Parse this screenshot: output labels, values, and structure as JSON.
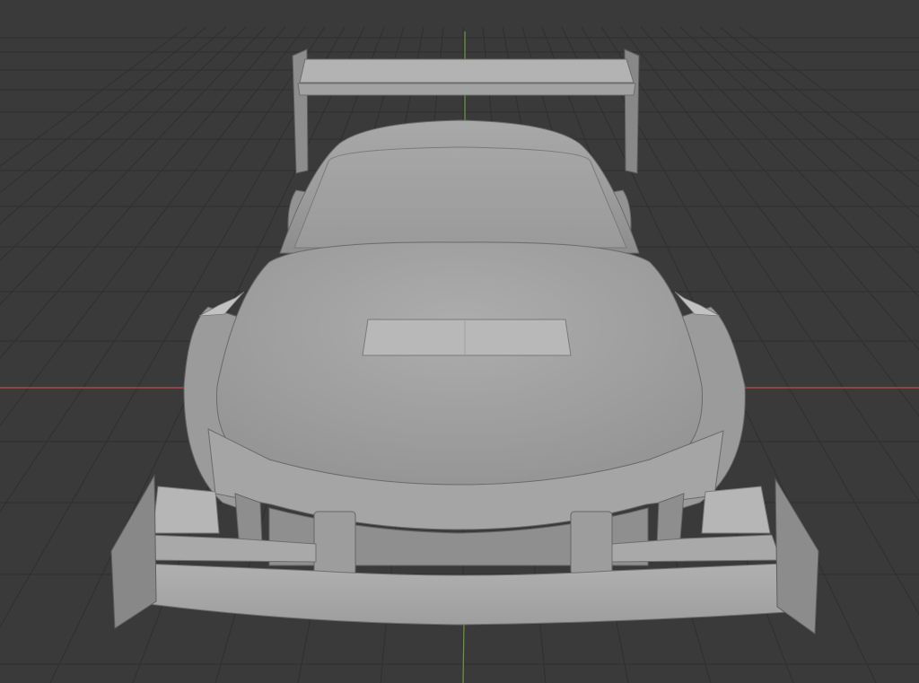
{
  "viewport": {
    "background_color": "#3a3a3a",
    "grid_color": "#2f2f2f",
    "x_axis_color": "#a9464b",
    "y_axis_color": "#6c9a3a",
    "model_base_color": "#9a9a9a",
    "model_highlight_color": "#b5b5b5",
    "model_shadow_color": "#6e6e6e"
  },
  "scene": {
    "object": "car-body-mesh",
    "shading": "solid",
    "view": "front-perspective"
  }
}
